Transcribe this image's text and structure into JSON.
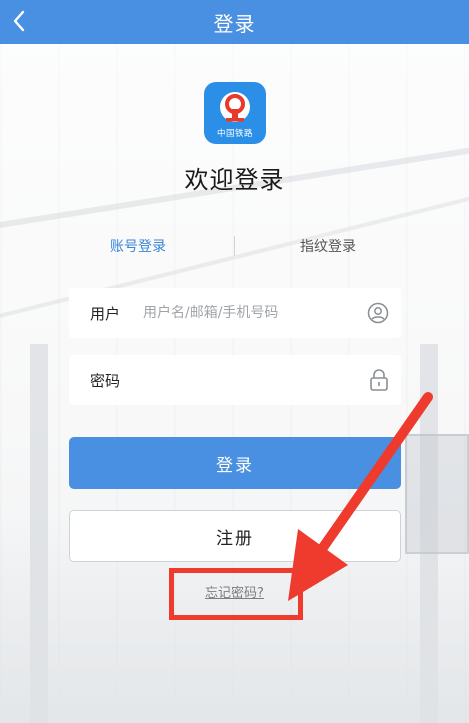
{
  "header": {
    "title": "登录"
  },
  "logo": {
    "text": "中国铁路"
  },
  "welcome": "欢迎登录",
  "tabs": [
    {
      "label": "账号登录",
      "active": true
    },
    {
      "label": "指纹登录",
      "active": false
    }
  ],
  "fields": {
    "user": {
      "label": "用户",
      "placeholder": "用户名/邮箱/手机号码",
      "value": ""
    },
    "password": {
      "label": "密码",
      "placeholder": "",
      "value": ""
    }
  },
  "buttons": {
    "login": "登录",
    "register": "注册"
  },
  "forgot_link": "忘记密码?",
  "colors": {
    "brand": "#4a90e2",
    "annotation": "#ee3b2e"
  },
  "icons": [
    "back-arrow-icon",
    "railway-logo-icon",
    "user-circle-icon",
    "lock-icon",
    "annotation-arrow"
  ]
}
